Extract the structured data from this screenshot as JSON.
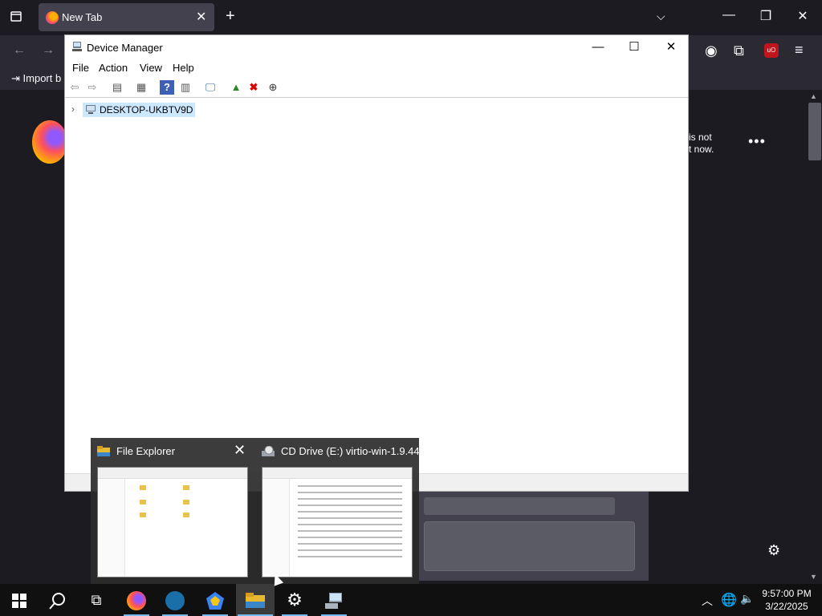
{
  "firefox": {
    "tab_title": "New Tab",
    "bookmark_import": "Import b",
    "notice_line1": "is not",
    "notice_line2": "t now.",
    "dots": "•••"
  },
  "device_manager": {
    "title": "Device Manager",
    "menu": [
      "File",
      "Action",
      "View",
      "Help"
    ],
    "tree_root": "DESKTOP-UKBTV9D",
    "window_controls": {
      "minimize": "—",
      "maximize": "☐",
      "close": "✕"
    }
  },
  "thumbnails": [
    {
      "title": "File Explorer"
    },
    {
      "title": "CD Drive (E:) virtio-win-1.9.44"
    }
  ],
  "taskbar": {
    "time": "9:57:00 PM",
    "date": "3/22/2025"
  },
  "colors": {
    "firefox_bg": "#1c1b22",
    "selection": "#cce8ff",
    "taskbar": "#101010",
    "accent": "#76b9ed"
  }
}
